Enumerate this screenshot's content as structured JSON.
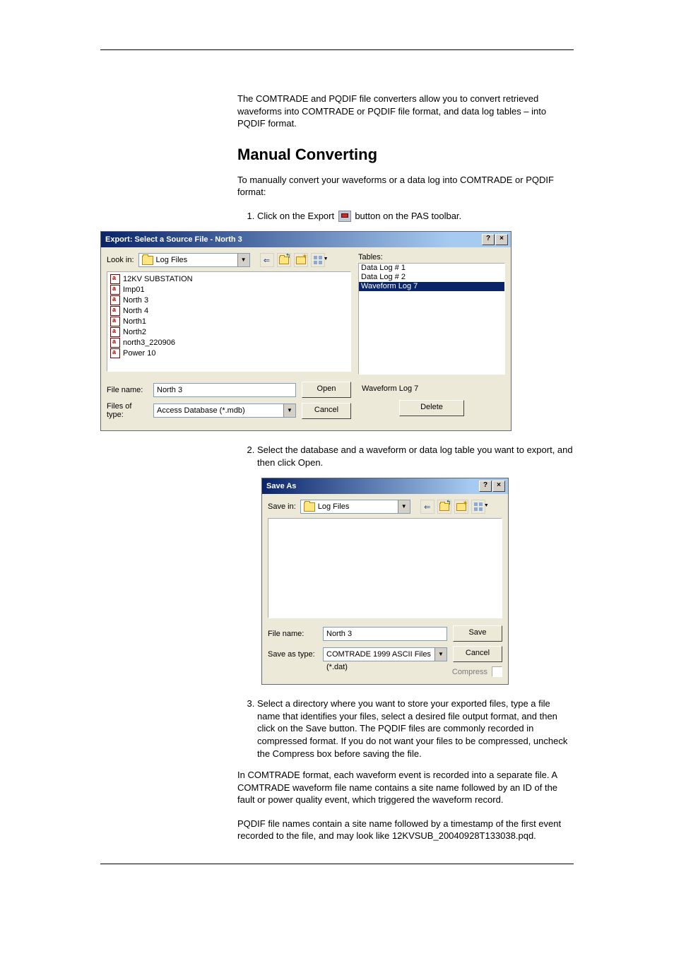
{
  "intro_paragraph": "The COMTRADE and PQDIF file converters allow you to convert retrieved waveforms into COMTRADE or PQDIF file format, and data log tables – into PQDIF format.",
  "section_heading": "Manual Converting",
  "intro_paragraph2": "To manually convert your waveforms or a data log into COMTRADE or PQDIF format:",
  "step1_before": "Click on the Export ",
  "step1_after": " button on the PAS toolbar.",
  "export_dialog": {
    "title": "Export: Select a Source File - North 3",
    "look_in_label": "Look in:",
    "look_in_value": "Log Files",
    "files": [
      "12KV SUBSTATION",
      "Imp01",
      "North 3",
      "North 4",
      "North1",
      "North2",
      "north3_220906",
      "Power 10"
    ],
    "tables_label": "Tables:",
    "tables": [
      "Data Log # 1",
      "Data Log # 2",
      "Waveform Log 7"
    ],
    "tables_selected_index": 2,
    "file_name_label": "File name:",
    "file_name_value": "North 3",
    "files_of_type_label": "Files of type:",
    "files_of_type_value": "Access Database (*.mdb)",
    "open_button": "Open",
    "cancel_button": "Cancel",
    "selected_table_display": "Waveform Log 7",
    "delete_button": "Delete",
    "help_sys": "?",
    "close_sys": "×"
  },
  "step2": "Select the database and a waveform or data log table you want to export, and then click Open.",
  "saveas_dialog": {
    "title": "Save As",
    "save_in_label": "Save in:",
    "save_in_value": "Log Files",
    "file_name_label": "File name:",
    "file_name_value": "North 3",
    "save_as_type_label": "Save as type:",
    "save_as_type_value": "COMTRADE 1999 ASCII Files (*.dat)",
    "save_button": "Save",
    "cancel_button": "Cancel",
    "compress_label": "Compress",
    "help_sys": "?",
    "close_sys": "×"
  },
  "step3": "Select a directory where you want to store your exported files, type a file name that identifies your files, select a desired file output format, and then click on the Save button. The PQDIF files are commonly recorded in compressed format. If you do not want your files to be compressed, uncheck the Compress box before saving the file.",
  "tail_para1": "In COMTRADE format, each waveform event is recorded into a separate file. A COMTRADE waveform file name contains a site name followed by an ID of the fault or power quality event, which triggered the waveform record.",
  "tail_para2": "PQDIF file names contain a site name followed by a timestamp of the first event recorded to the file, and may look like 12KVSUB_20040928T133038.pqd."
}
